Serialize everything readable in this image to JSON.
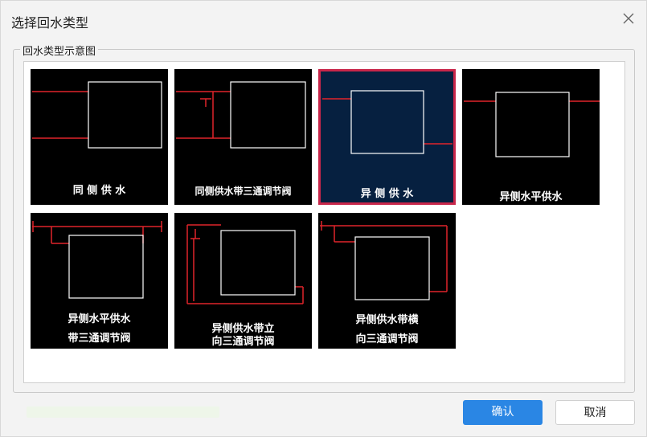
{
  "dialog": {
    "title": "选择回水类型",
    "group_label": "回水类型示意图",
    "options": [
      {
        "label": "同 侧 供 水"
      },
      {
        "label": "同侧供水带三通调节阀"
      },
      {
        "label": "异 侧 供 水",
        "selected": true
      },
      {
        "label": "异侧水平供水"
      },
      {
        "label_line1": "异侧水平供水",
        "label_line2": "带三通调节阀"
      },
      {
        "label_line1": "异侧供水带立",
        "label_line2": "向三通调节阀"
      },
      {
        "label_line1": "异侧供水带横",
        "label_line2": "向三通调节阀"
      }
    ],
    "confirm_label": "确认",
    "cancel_label": "取消"
  },
  "colors": {
    "primary": "#2a86e4",
    "selected_border": "#c8264a",
    "pipe": "#e0242a"
  },
  "icons": {
    "close": "close-icon"
  }
}
